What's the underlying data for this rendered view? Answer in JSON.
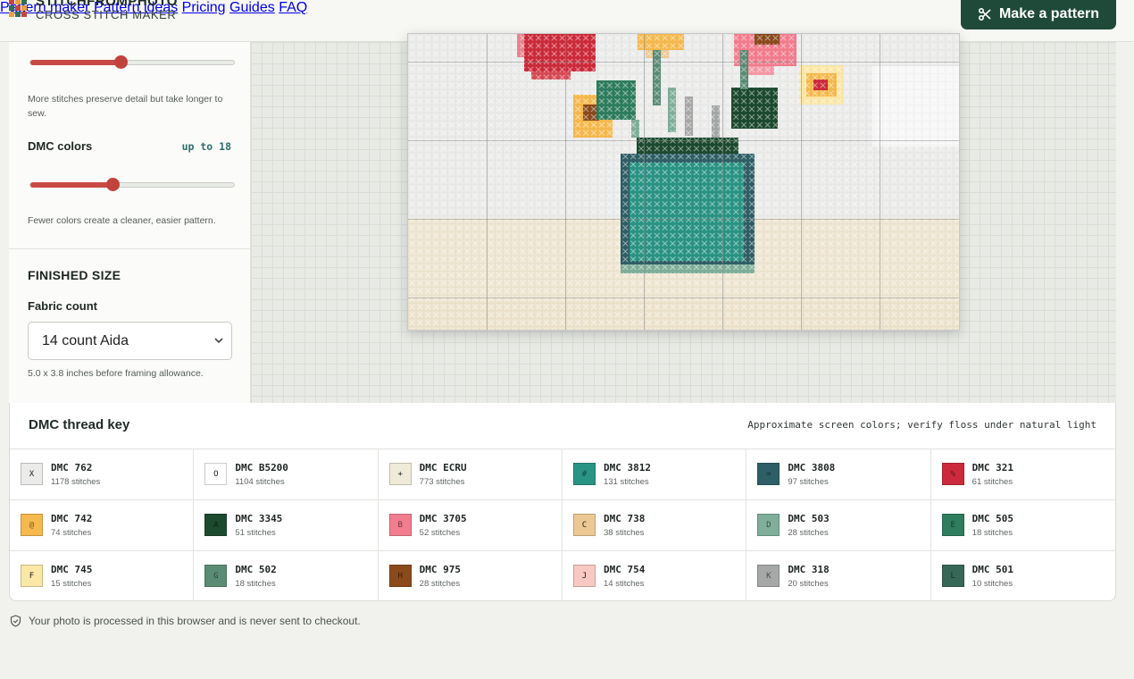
{
  "brand": {
    "name": "STITCHFROMPHOTO",
    "sub": "CROSS STITCH MAKER"
  },
  "nav": {
    "items": [
      {
        "label": "Pattern maker"
      },
      {
        "label": "Pattern ideas"
      },
      {
        "label": "Pricing"
      },
      {
        "label": "Guides"
      },
      {
        "label": "FAQ"
      }
    ]
  },
  "cta": {
    "label": "Make a pattern",
    "icon": "scissors-icon"
  },
  "settings": {
    "stitch_help": "More stitches preserve detail but take longer to sew.",
    "stitch_slider_level": 0.44,
    "colors_label": "DMC colors",
    "colors_value": "up to 18",
    "colors_slider_level": 0.4,
    "colors_help": "Fewer colors create a cleaner, easier pattern.",
    "finished_size_title": "FINISHED SIZE",
    "fabric_label": "Fabric count",
    "fabric_value": "14 count Aida",
    "fabric_help": "5.0 x 3.8 inches before framing allowance."
  },
  "key": {
    "title": "DMC thread key",
    "note": "Approximate screen colors; verify floss under natural light",
    "threads": [
      {
        "symbol": "X",
        "code": "DMC 762",
        "count": "1178 stitches",
        "color": "#ebebea"
      },
      {
        "symbol": "O",
        "code": "DMC B5200",
        "count": "1104 stitches",
        "color": "#ffffff"
      },
      {
        "symbol": "+",
        "code": "DMC ECRU",
        "count": "773 stitches",
        "color": "#f0ead8"
      },
      {
        "symbol": "#",
        "code": "DMC 3812",
        "count": "131 stitches",
        "color": "#2a9484"
      },
      {
        "symbol": "=",
        "code": "DMC 3808",
        "count": "97 stitches",
        "color": "#2f5f66"
      },
      {
        "symbol": "%",
        "code": "DMC 321",
        "count": "61 stitches",
        "color": "#cc2a3a"
      },
      {
        "symbol": "@",
        "code": "DMC 742",
        "count": "74 stitches",
        "color": "#f6b94e"
      },
      {
        "symbol": "A",
        "code": "DMC 3345",
        "count": "51 stitches",
        "color": "#1c4a2e"
      },
      {
        "symbol": "B",
        "code": "DMC 3705",
        "count": "52 stitches",
        "color": "#f27d8e"
      },
      {
        "symbol": "C",
        "code": "DMC 738",
        "count": "38 stitches",
        "color": "#ecc994"
      },
      {
        "symbol": "D",
        "code": "DMC 503",
        "count": "28 stitches",
        "color": "#7faf9a"
      },
      {
        "symbol": "E",
        "code": "DMC 505",
        "count": "18 stitches",
        "color": "#2e7d5e"
      },
      {
        "symbol": "F",
        "code": "DMC 745",
        "count": "15 stitches",
        "color": "#fbe7a6"
      },
      {
        "symbol": "G",
        "code": "DMC 502",
        "count": "18 stitches",
        "color": "#5a8c74"
      },
      {
        "symbol": "H",
        "code": "DMC 975",
        "count": "28 stitches",
        "color": "#8a4a1c"
      },
      {
        "symbol": "J",
        "code": "DMC 754",
        "count": "14 stitches",
        "color": "#f7c9c1"
      },
      {
        "symbol": "K",
        "code": "DMC 318",
        "count": "20 stitches",
        "color": "#a6a8a8"
      },
      {
        "symbol": "L",
        "code": "DMC 501",
        "count": "10 stitches",
        "color": "#376757"
      }
    ]
  },
  "footer": {
    "privacy": "Your photo is processed in this browser and is never sent to checkout.",
    "icon": "shield-check-icon"
  }
}
